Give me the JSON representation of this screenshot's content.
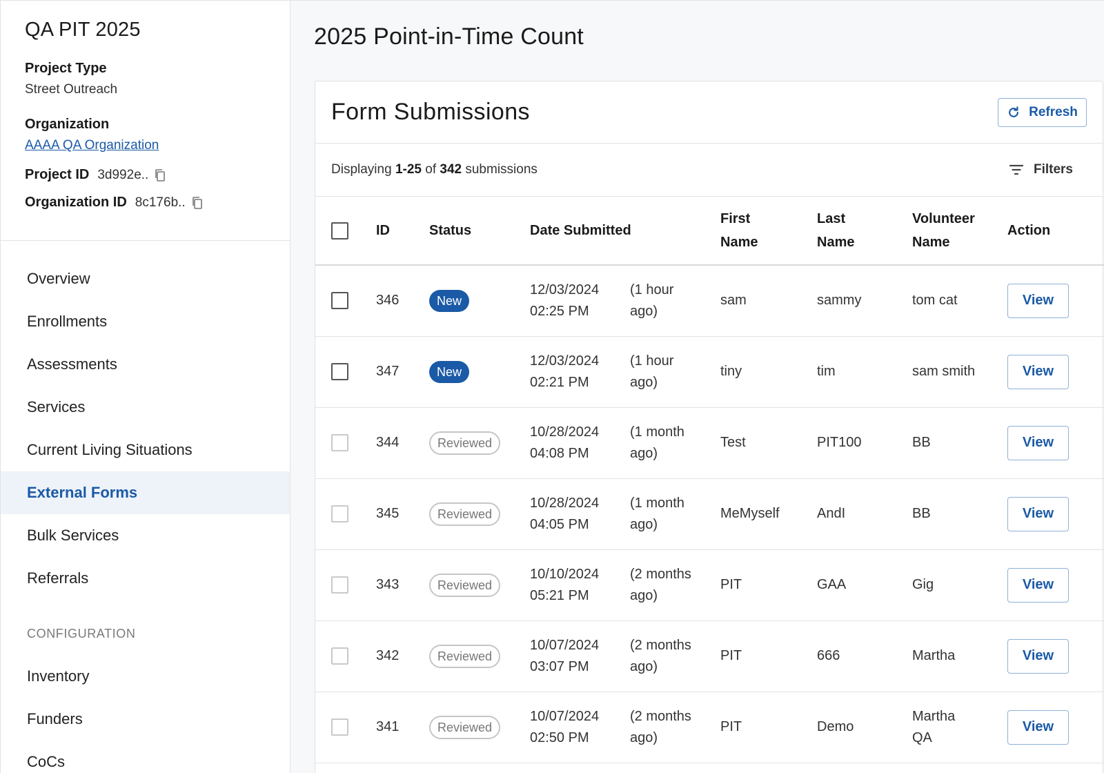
{
  "sidebar": {
    "project_title": "QA PIT 2025",
    "project_type_label": "Project Type",
    "project_type_value": "Street Outreach",
    "organization_label": "Organization",
    "organization_value": "AAAA QA Organization",
    "project_id_label": "Project ID",
    "project_id_value": "3d992e..",
    "organization_id_label": "Organization ID",
    "organization_id_value": "8c176b..",
    "nav_items": [
      {
        "label": "Overview"
      },
      {
        "label": "Enrollments"
      },
      {
        "label": "Assessments"
      },
      {
        "label": "Services"
      },
      {
        "label": "Current Living Situations"
      },
      {
        "label": "External Forms"
      },
      {
        "label": "Bulk Services"
      },
      {
        "label": "Referrals"
      }
    ],
    "active_item": "External Forms",
    "config_section_label": "CONFIGURATION",
    "config_items": [
      {
        "label": "Inventory"
      },
      {
        "label": "Funders"
      },
      {
        "label": "CoCs"
      }
    ]
  },
  "main": {
    "page_title": "2025 Point-in-Time Count",
    "card_title": "Form Submissions",
    "refresh_label": "Refresh",
    "filters_label": "Filters",
    "display_prefix": "Displaying ",
    "display_range": "1-25",
    "display_of": " of ",
    "display_total": "342",
    "display_suffix": " submissions"
  },
  "table": {
    "headers": {
      "id": "ID",
      "status": "Status",
      "date_submitted": "Date Submitted",
      "first_name_1": "First",
      "first_name_2": "Name",
      "last_name_1": "Last",
      "last_name_2": "Name",
      "volunteer_1": "Volunteer",
      "volunteer_2": "Name",
      "action": "Action"
    },
    "view_label": "View",
    "rows": [
      {
        "id": "346",
        "status": "New",
        "date": "12/03/2024",
        "time": "02:25 PM",
        "rel_1": "(1 hour",
        "rel_2": "ago)",
        "first": "sam",
        "last": "sammy",
        "volunteer_1": "tom cat",
        "volunteer_2": ""
      },
      {
        "id": "347",
        "status": "New",
        "date": "12/03/2024",
        "time": "02:21 PM",
        "rel_1": "(1 hour",
        "rel_2": "ago)",
        "first": "tiny",
        "last": "tim",
        "volunteer_1": "sam smith",
        "volunteer_2": ""
      },
      {
        "id": "344",
        "status": "Reviewed",
        "date": "10/28/2024",
        "time": "04:08 PM",
        "rel_1": "(1 month",
        "rel_2": "ago)",
        "first": "Test",
        "last": "PIT100",
        "volunteer_1": "BB",
        "volunteer_2": ""
      },
      {
        "id": "345",
        "status": "Reviewed",
        "date": "10/28/2024",
        "time": "04:05 PM",
        "rel_1": "(1 month",
        "rel_2": "ago)",
        "first": "MeMyself",
        "last": "AndI",
        "volunteer_1": "BB",
        "volunteer_2": ""
      },
      {
        "id": "343",
        "status": "Reviewed",
        "date": "10/10/2024",
        "time": "05:21 PM",
        "rel_1": "(2 months",
        "rel_2": "ago)",
        "first": "PIT",
        "last": "GAA",
        "volunteer_1": "Gig",
        "volunteer_2": ""
      },
      {
        "id": "342",
        "status": "Reviewed",
        "date": "10/07/2024",
        "time": "03:07 PM",
        "rel_1": "(2 months",
        "rel_2": "ago)",
        "first": "PIT",
        "last": "666",
        "volunteer_1": "Martha",
        "volunteer_2": ""
      },
      {
        "id": "341",
        "status": "Reviewed",
        "date": "10/07/2024",
        "time": "02:50 PM",
        "rel_1": "(2 months",
        "rel_2": "ago)",
        "first": "PIT",
        "last": "Demo",
        "volunteer_1": "Martha",
        "volunteer_2": "QA"
      }
    ]
  },
  "colors": {
    "accent": "#1a5aa6",
    "active_nav_bg": "#eef3f9",
    "badge_new_bg": "#1a5aa6",
    "badge_reviewed_border": "#c5c5c5"
  },
  "icons": {
    "copy": "copy-icon",
    "refresh": "refresh-icon",
    "filters": "filter-icon"
  }
}
